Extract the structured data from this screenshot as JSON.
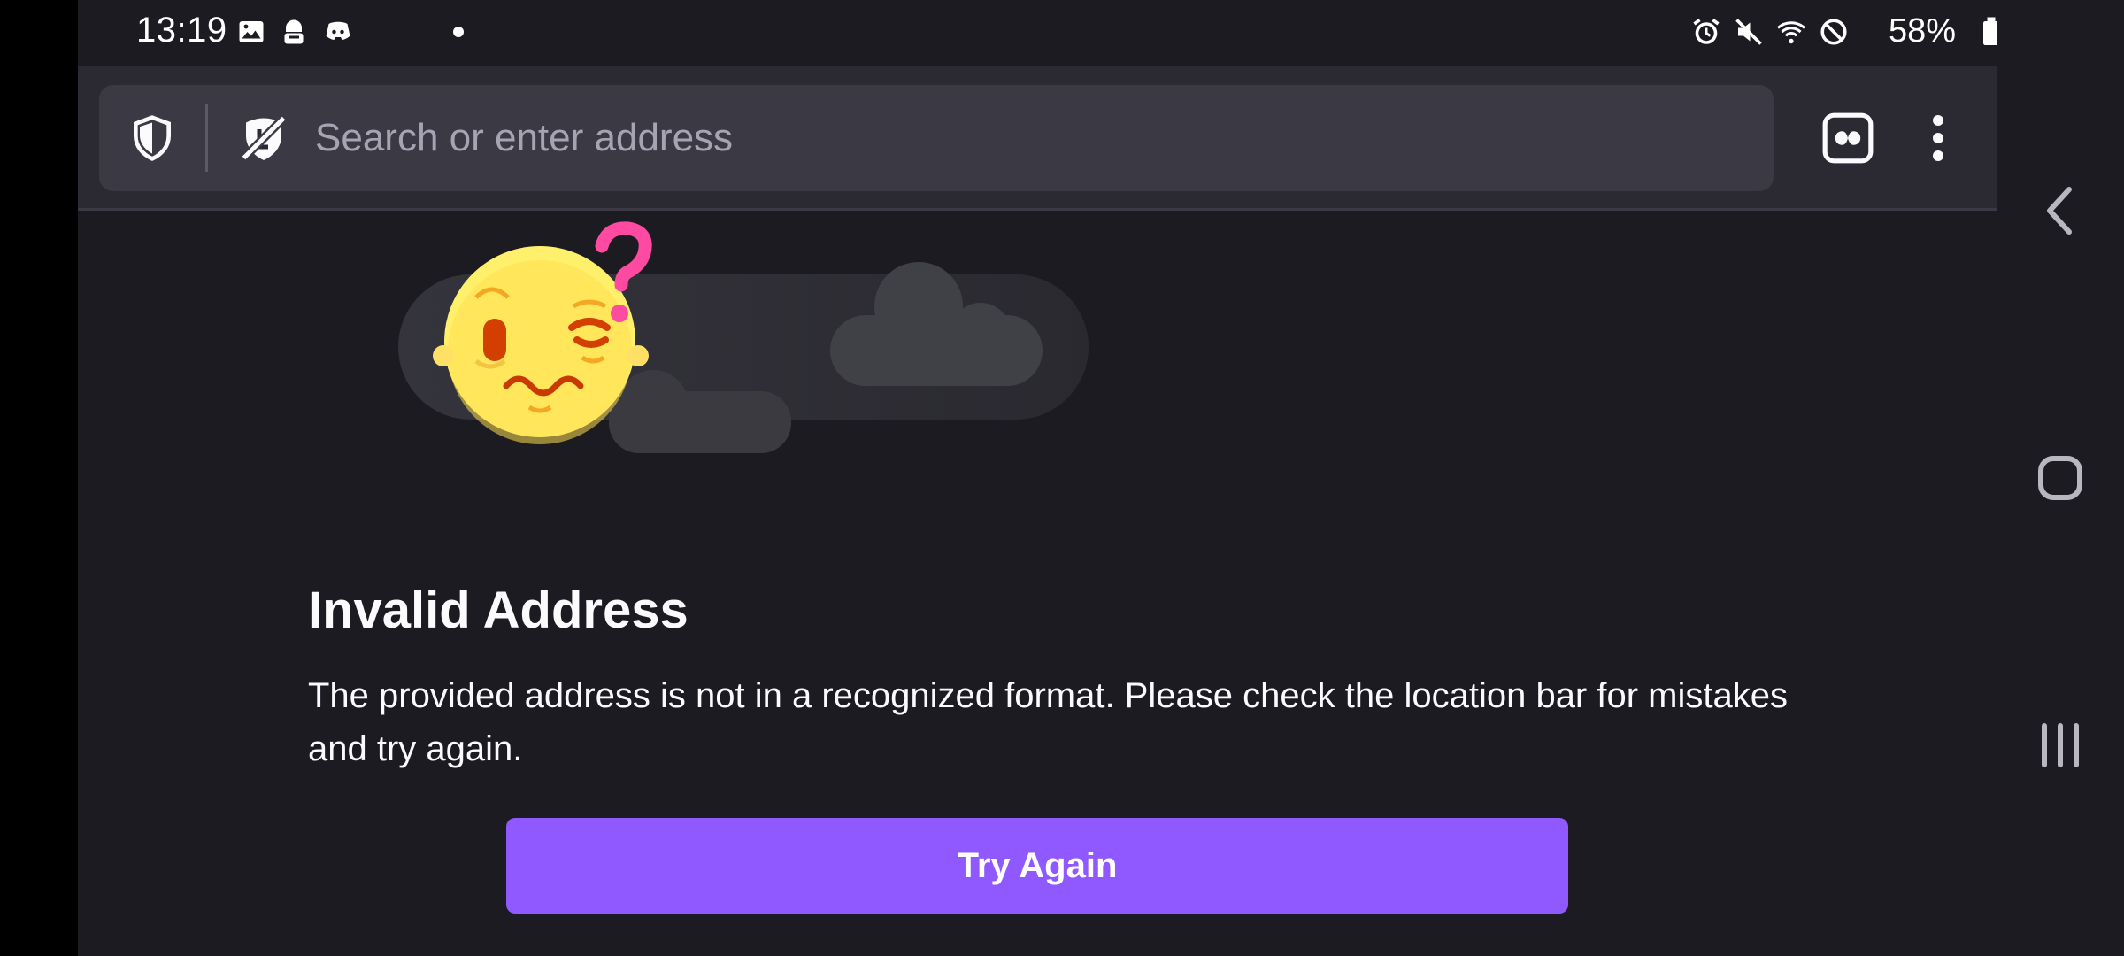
{
  "status_bar": {
    "time": "13:19",
    "battery": "58%",
    "left_icons": [
      "gallery-icon",
      "incognito-icon",
      "discord-icon",
      "dot-icon"
    ],
    "right_icons": [
      "alarm-icon",
      "mute-icon",
      "wifi-icon",
      "do-not-disturb-icon",
      "battery-icon"
    ]
  },
  "toolbar": {
    "url_placeholder": "Search or enter address",
    "icons": [
      "shield-icon",
      "tracking-protection-off-icon",
      "private-tabs-icon",
      "more-menu-icon"
    ]
  },
  "error_page": {
    "title": "Invalid Address",
    "message": "The provided address is not in a recognized format. Please check the location bar for mistakes and try again.",
    "button_label": "Try Again"
  },
  "colors": {
    "background": "#1c1b22",
    "toolbar": "#2b2a33",
    "urlbar": "#3a3944",
    "accent": "#9059ff",
    "text": "#fbfbfe"
  },
  "nav_bar": {
    "icons": [
      "back-icon",
      "home-icon",
      "recents-icon"
    ]
  }
}
